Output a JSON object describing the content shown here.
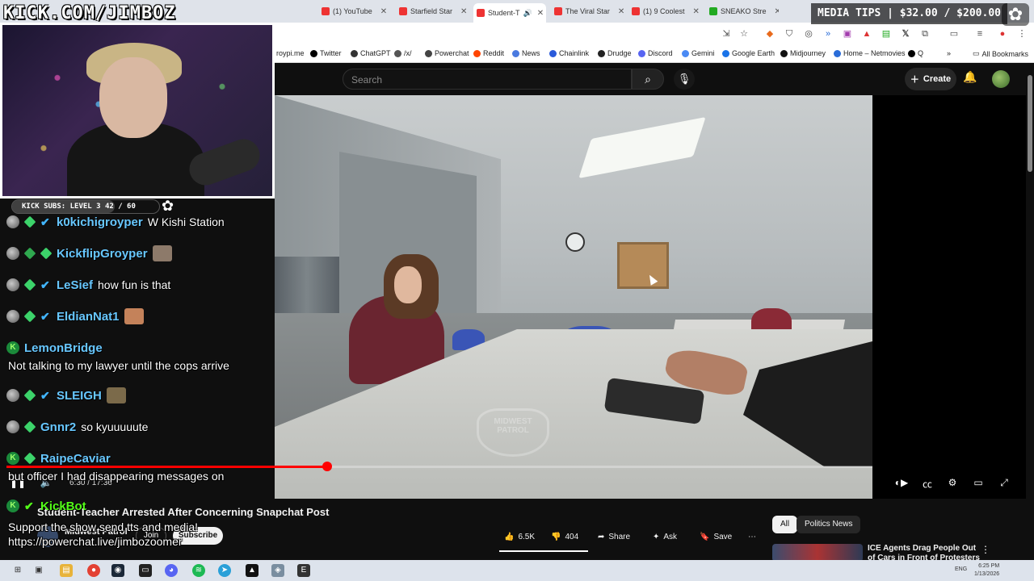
{
  "browser": {
    "tabs": [
      {
        "title": "(1) YouTube",
        "color": "#e33"
      },
      {
        "title": "Starfield Star",
        "color": "#e33"
      },
      {
        "title": "Student-T",
        "color": "#e33"
      },
      {
        "title": "The Viral Star",
        "color": "#e33"
      },
      {
        "title": "(1) 9 Coolest",
        "color": "#e33"
      },
      {
        "title": "SNEAKO Stre",
        "color": "#2a2"
      }
    ],
    "bookmarks": [
      "roypi.me",
      "Twitter",
      "ChatGPT",
      "/x/",
      "Powerchat",
      "Reddit",
      "News",
      "Chainlink",
      "Drudge",
      "Discord",
      "Gemini",
      "Google Earth",
      "Midjourney",
      "Home – Netmovies",
      "Q"
    ],
    "all_bookmarks": "All Bookmarks"
  },
  "youtube": {
    "search_placeholder": "Search",
    "create_label": "Create",
    "video": {
      "title": "Student-Teacher Arrested After Concerning Snapchat Post",
      "channel": "Midwest Patrol",
      "join_label": "Join",
      "subscribe_label": "Subscribe",
      "time": "6:30 / 17:36",
      "progress": 0.37,
      "watermark": "MIDWEST PATROL"
    },
    "actions": {
      "likes": "6.5K",
      "dislikes": "404",
      "share": "Share",
      "ask": "Ask",
      "save": "Save"
    },
    "chips": [
      "All",
      "Politics News"
    ],
    "recommendation": {
      "title": "ICE Agents Drag People Out of Cars in Front of Protesters"
    }
  },
  "overlay": {
    "url_banner": "KICK.COM/JIMBOZ",
    "media_tips": "MEDIA TIPS | $32.00 / $200.00",
    "tips_progress": 0.16,
    "subs_label": "KICK SUBS: LEVEL 3 42 / 60",
    "subs_progress": 0.7,
    "chat": [
      {
        "user": "k0kichigroyper",
        "text": "W Kishi Station",
        "color": "blue"
      },
      {
        "user": "KickflipGroyper",
        "text": "",
        "color": "blue"
      },
      {
        "user": "LeSief",
        "text": "how fun is that",
        "color": "blue"
      },
      {
        "user": "EldianNat1",
        "text": "",
        "color": "blue"
      },
      {
        "user": "LemonBridge",
        "text": "Not talking to my lawyer until the cops arrive",
        "color": "green"
      },
      {
        "user": "SLEIGH",
        "text": "",
        "color": "blue"
      },
      {
        "user": "Gnnr2",
        "text": "so kyuuuuute",
        "color": "blue"
      },
      {
        "user": "RaipeCaviar",
        "text": "but officer I had disappearing messages on",
        "color": "blue"
      },
      {
        "user": "KickBot",
        "text": "Support the show send tts and media! https://powerchat.live/jimbozoomer",
        "color": "green"
      }
    ]
  },
  "taskbar": {
    "lang": "ENG",
    "time": "6:25 PM",
    "date": "1/13/2026"
  }
}
